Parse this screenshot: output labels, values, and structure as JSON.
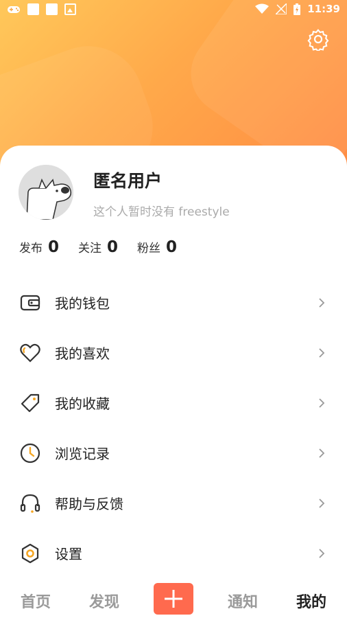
{
  "status_bar": {
    "time": "11:39"
  },
  "profile": {
    "username": "匿名用户",
    "bio": "这个人暂时没有 freestyle"
  },
  "stats": [
    {
      "label": "发布",
      "value": "0"
    },
    {
      "label": "关注",
      "value": "0"
    },
    {
      "label": "粉丝",
      "value": "0"
    }
  ],
  "menu": [
    {
      "label": "我的钱包",
      "icon": "wallet-icon"
    },
    {
      "label": "我的喜欢",
      "icon": "heart-icon"
    },
    {
      "label": "我的收藏",
      "icon": "tag-icon"
    },
    {
      "label": "浏览记录",
      "icon": "clock-icon"
    },
    {
      "label": "帮助与反馈",
      "icon": "headphones-icon"
    },
    {
      "label": "设置",
      "icon": "settings-hexagon-icon"
    }
  ],
  "tabbar": {
    "home": "首页",
    "discover": "发现",
    "notify": "通知",
    "mine": "我的"
  },
  "colors": {
    "accent": "#ff6a4e",
    "icon_highlight": "#f5a623",
    "header_start": "#ffc85a",
    "header_end": "#ff8b43"
  }
}
